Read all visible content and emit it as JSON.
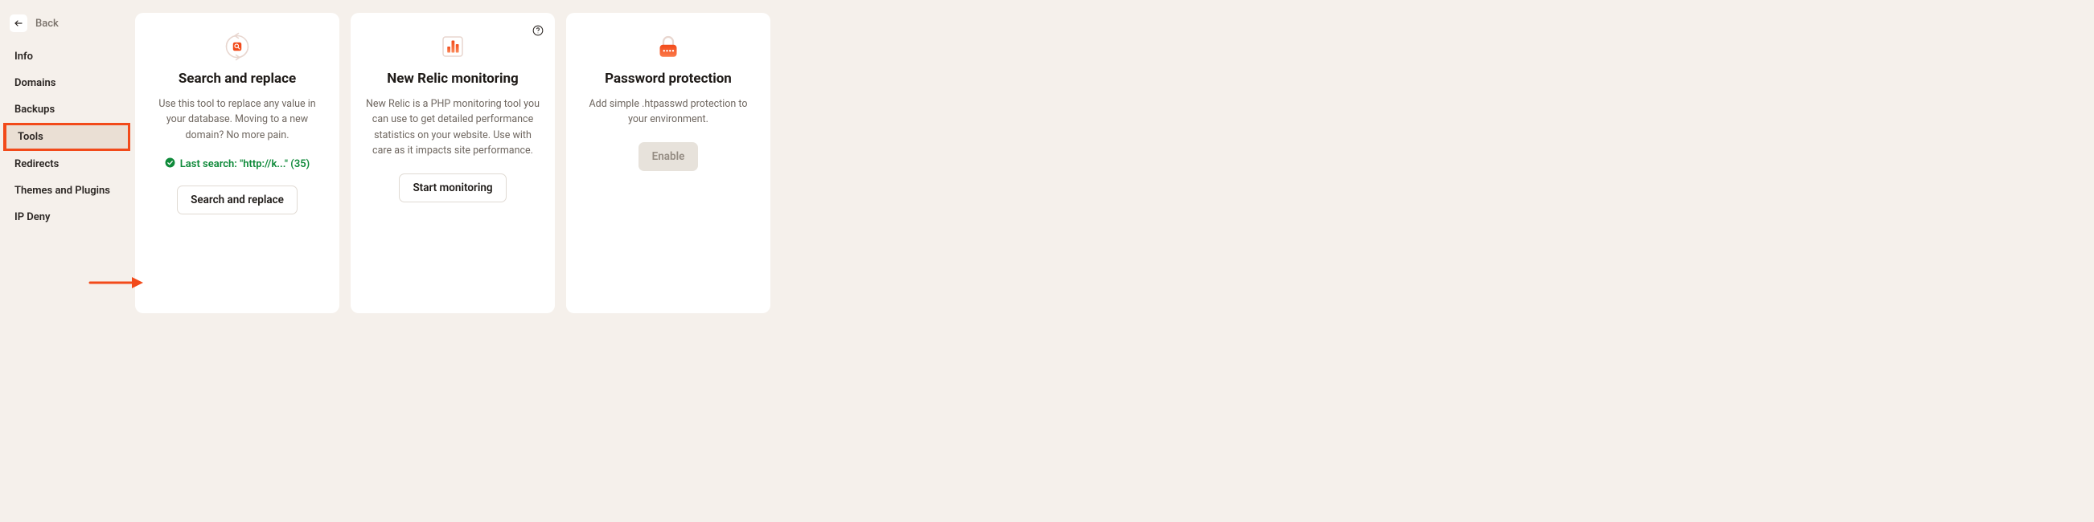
{
  "back": {
    "label": "Back"
  },
  "nav": {
    "items": [
      {
        "label": "Info"
      },
      {
        "label": "Domains"
      },
      {
        "label": "Backups"
      },
      {
        "label": "Tools"
      },
      {
        "label": "Redirects"
      },
      {
        "label": "Themes and Plugins"
      },
      {
        "label": "IP Deny"
      }
    ],
    "active_index": 3
  },
  "cards": {
    "search_replace": {
      "title": "Search and replace",
      "desc": "Use this tool to replace any value in your database. Moving to a new domain? No more pain.",
      "status": "Last search: \"http://k...\" (35)",
      "button": "Search and replace"
    },
    "new_relic": {
      "title": "New Relic monitoring",
      "desc": "New Relic is a PHP monitoring tool you can use to get detailed performance statistics on your website. Use with care as it impacts site performance.",
      "button": "Start monitoring"
    },
    "password_protection": {
      "title": "Password protection",
      "desc": "Add simple .htpasswd protection to your environment.",
      "button": "Enable"
    }
  }
}
